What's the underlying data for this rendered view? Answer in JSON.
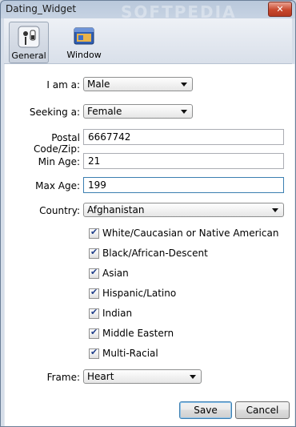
{
  "window": {
    "title": "Dating_Widget",
    "close_label": "✕",
    "watermark": "SOFTPEDIA"
  },
  "toolbar": {
    "tabs": [
      {
        "label": "General",
        "icon": "settings-switches-icon",
        "selected": true
      },
      {
        "label": "Window",
        "icon": "window-icon",
        "selected": false
      }
    ]
  },
  "form": {
    "i_am": {
      "label": "I am a:",
      "value": "Male"
    },
    "seeking": {
      "label": "Seeking a:",
      "value": "Female"
    },
    "postal": {
      "label": "Postal Code/Zip:",
      "value": "6667742"
    },
    "min_age": {
      "label": "Min Age:",
      "value": "21"
    },
    "max_age": {
      "label": "Max Age:",
      "value": "199"
    },
    "country": {
      "label": "Country:",
      "value": "Afghanistan"
    },
    "ethnicities": [
      {
        "label": "White/Caucasian or Native American",
        "checked": true
      },
      {
        "label": "Black/African-Descent",
        "checked": true
      },
      {
        "label": "Asian",
        "checked": true
      },
      {
        "label": "Hispanic/Latino",
        "checked": true
      },
      {
        "label": "Indian",
        "checked": true
      },
      {
        "label": "Middle Eastern",
        "checked": true
      },
      {
        "label": "Multi-Racial",
        "checked": true
      }
    ],
    "frame": {
      "label": "Frame:",
      "value": "Heart"
    }
  },
  "buttons": {
    "save": "Save",
    "cancel": "Cancel"
  },
  "check_mark": "✔"
}
